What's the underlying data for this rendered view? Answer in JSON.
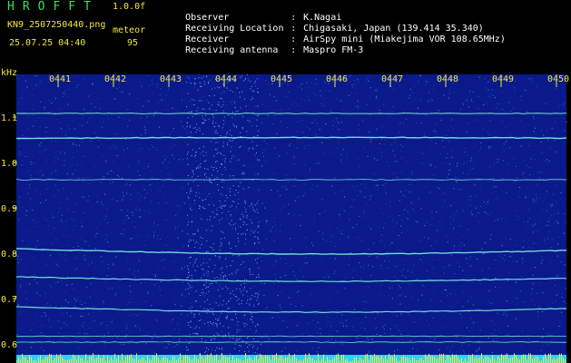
{
  "header": {
    "app_title": "HROFFT",
    "version": "1.0.0f",
    "filename": "KN9_2507250440.png",
    "meteor_label": "meteor",
    "datetime": "25.07.25 04:40",
    "meteor_count": "95"
  },
  "observation": [
    {
      "key": "Observer",
      "value": "K.Nagai"
    },
    {
      "key": "Receiving Location",
      "value": "Chigasaki, Japan (139.414 35.340)"
    },
    {
      "key": "Receiver",
      "value": "AirSpy mini (Miakejima VOR 108.65MHz)"
    },
    {
      "key": "Receiving antenna",
      "value": "Maspro FM-3"
    }
  ],
  "separator": ":",
  "spectrogram": {
    "y_unit": "kHz",
    "y_ticks": [
      "1.1",
      "1.0",
      "0.9",
      "0.8",
      "0.7",
      "0.6"
    ],
    "x_ticks": [
      "0441",
      "0442",
      "0443",
      "0444",
      "0445",
      "0446",
      "0447",
      "0448",
      "0449",
      "0450"
    ],
    "background_color": "#0a1a8a",
    "signal_color": "#7ff0e6",
    "tick_color": "#f2e83a",
    "bottom_bar_color": "#22d6ff"
  }
}
